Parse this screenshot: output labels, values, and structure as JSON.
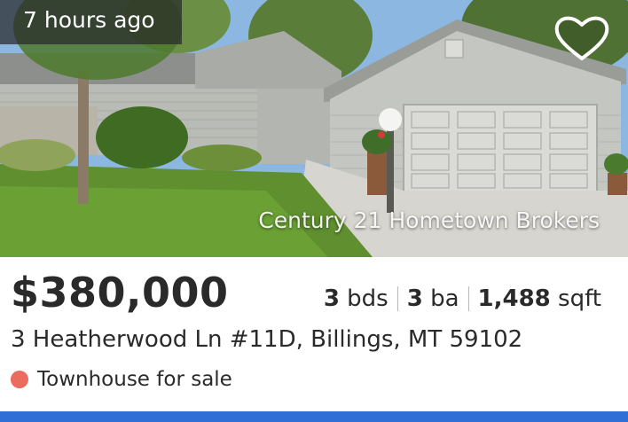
{
  "listing": {
    "time_badge": "7 hours ago",
    "photo_credit": "Century 21 Hometown Brokers",
    "price": "$380,000",
    "beds_value": "3",
    "beds_unit": "bds",
    "baths_value": "3",
    "baths_unit": "ba",
    "sqft_value": "1,488",
    "sqft_unit": "sqft",
    "address": "3 Heatherwood Ln #11D, Billings, MT 59102",
    "status_text": "Townhouse for sale",
    "status_color": "#ec6a5e"
  },
  "icons": {
    "favorite": "heart-outline-icon"
  },
  "colors": {
    "accent": "#2f6fd6",
    "text": "#2a2a2a"
  }
}
